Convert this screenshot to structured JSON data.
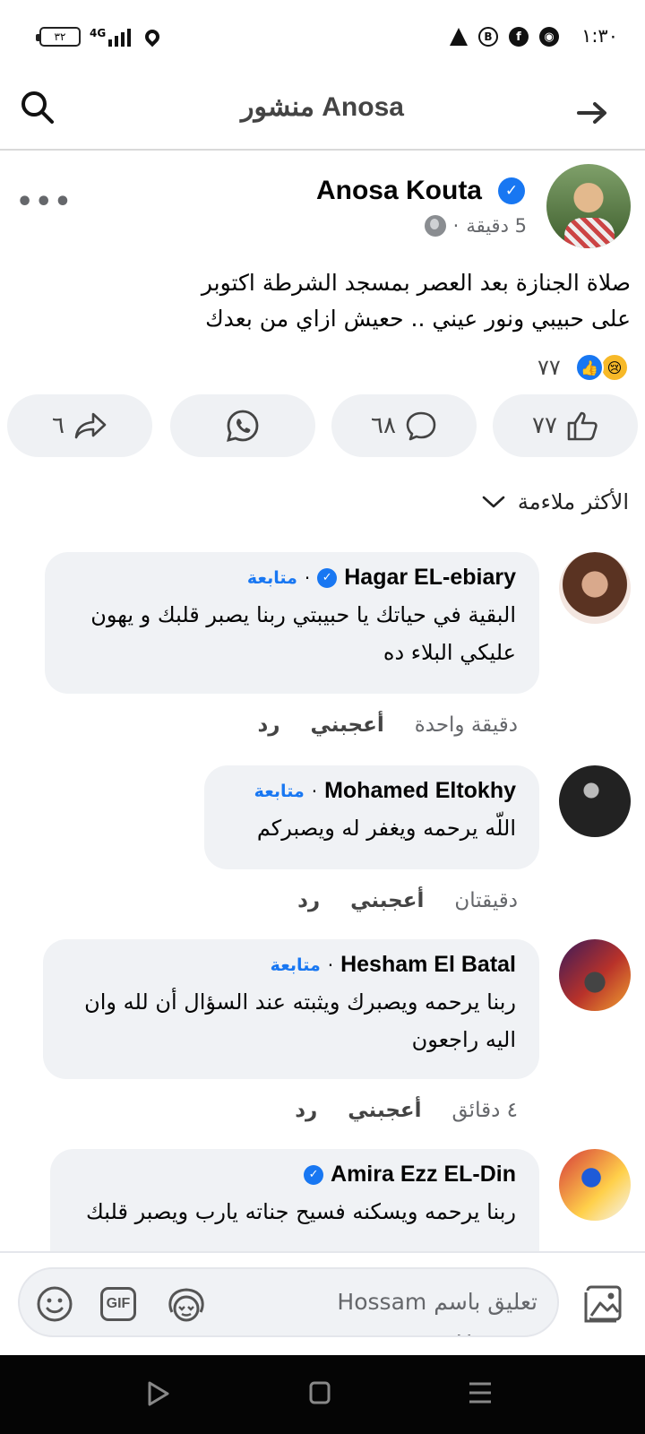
{
  "status_bar": {
    "time": "١:٣٠",
    "battery": "٣٢",
    "network": "4G"
  },
  "header": {
    "title": "منشور Anosa"
  },
  "post": {
    "author": "Anosa Kouta",
    "time": "5 دقيقة",
    "text_line1": "صلاة الجنازة بعد العصر بمسجد الشرطة اكتوبر",
    "text_line2": "على حبيبي ونور عيني .. حعيش ازاي من بعدك",
    "reaction_count": "٧٧"
  },
  "actions": {
    "like_count": "٧٧",
    "comment_count": "٦٨",
    "share_count": "٦"
  },
  "sort_label": "الأكثر ملاءمة",
  "comments": [
    {
      "name": "Hagar EL-ebiary",
      "follow": "متابعة",
      "text": "البقية في حياتك يا حبيبتي ربنا يصبر قلبك و يهون عليكي البلاء ده",
      "time": "دقيقة واحدة",
      "like": "أعجبني",
      "reply": "رد"
    },
    {
      "name": "Mohamed Eltokhy",
      "follow": "متابعة",
      "text": "اللّه يرحمه ويغفر له ويصبركم",
      "time": "دقيقتان",
      "like": "أعجبني",
      "reply": "رد"
    },
    {
      "name": "Hesham El Batal",
      "follow": "متابعة",
      "text": "ربنا يرحمه ويصبرك ويثبته عند السؤال أن لله وان اليه راجعون",
      "time": "٤ دقائق",
      "like": "أعجبني",
      "reply": "رد"
    },
    {
      "name": "Amira Ezz EL-Din",
      "text": "ربنا يرحمه ويسكنه فسيح جناته يارب ويصبر قلبك"
    }
  ],
  "composer": {
    "placeholder": "تعليق باسم Hossam Hassan",
    "gif": "GIF"
  },
  "colors": {
    "accent": "#1877f2",
    "bubble": "#f0f2f5",
    "secondary_text": "#65676b"
  }
}
